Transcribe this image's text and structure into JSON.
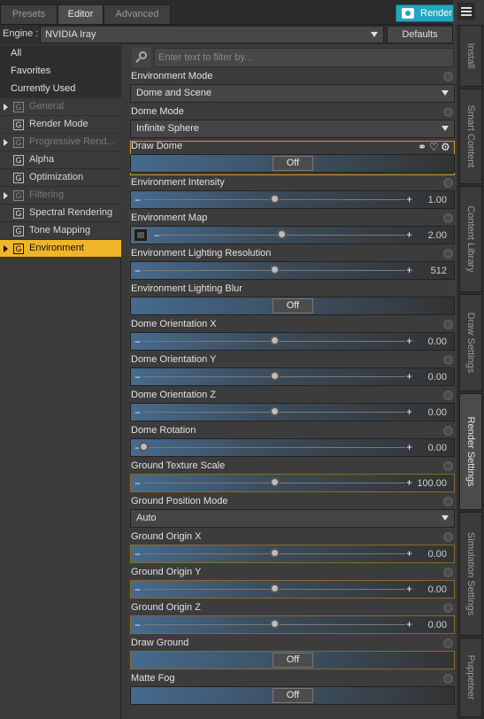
{
  "tabs": {
    "presets": "Presets",
    "editor": "Editor",
    "advanced": "Advanced"
  },
  "render_label": "Render",
  "engine": {
    "label": "Engine :",
    "value": "NVIDIA Iray",
    "defaults_label": "Defaults"
  },
  "search": {
    "placeholder": "Enter text to filter by..."
  },
  "nav": {
    "all": "All",
    "favorites": "Favorites",
    "currently_used": "Currently Used",
    "groups": [
      {
        "label": "General"
      },
      {
        "label": "Render Mode"
      },
      {
        "label": "Progressive Rend..."
      },
      {
        "label": "Alpha"
      },
      {
        "label": "Optimization"
      },
      {
        "label": "Filtering"
      },
      {
        "label": "Spectral Rendering"
      },
      {
        "label": "Tone Mapping"
      },
      {
        "label": "Environment"
      }
    ]
  },
  "props": [
    {
      "label": "Environment Mode",
      "value": "Dome and Scene"
    },
    {
      "label": "Dome Mode",
      "value": "Infinite Sphere"
    },
    {
      "label": "Draw Dome",
      "value": "Off"
    },
    {
      "label": "Environment Intensity",
      "value": "1.00",
      "level": 0.5
    },
    {
      "label": "Environment Map",
      "value": "2.00",
      "level": 0.5
    },
    {
      "label": "Environment Lighting Resolution",
      "value": "512",
      "level": 0.5
    },
    {
      "label": "Environment Lighting Blur",
      "value": "Off"
    },
    {
      "label": "Dome Orientation X",
      "value": "0.00",
      "level": 0.5
    },
    {
      "label": "Dome Orientation Y",
      "value": "0.00",
      "level": 0.5
    },
    {
      "label": "Dome Orientation Z",
      "value": "0.00",
      "level": 0.5
    },
    {
      "label": "Dome Rotation",
      "value": "0.00",
      "level": 0.0
    },
    {
      "label": "Ground Texture Scale",
      "value": "100.00",
      "level": 0.5
    },
    {
      "label": "Ground Position Mode",
      "value": "Auto"
    },
    {
      "label": "Ground Origin X",
      "value": "0.00",
      "level": 0.5
    },
    {
      "label": "Ground Origin Y",
      "value": "0.00",
      "level": 0.5
    },
    {
      "label": "Ground Origin Z",
      "value": "0.00",
      "level": 0.5
    },
    {
      "label": "Draw Ground",
      "value": "Off"
    },
    {
      "label": "Matte Fog",
      "value": "Off"
    }
  ],
  "side_tabs": [
    "Install",
    "Smart Content",
    "Content Library",
    "Draw Settings",
    "Render Settings",
    "Simulation Settings",
    "Puppeteer"
  ]
}
